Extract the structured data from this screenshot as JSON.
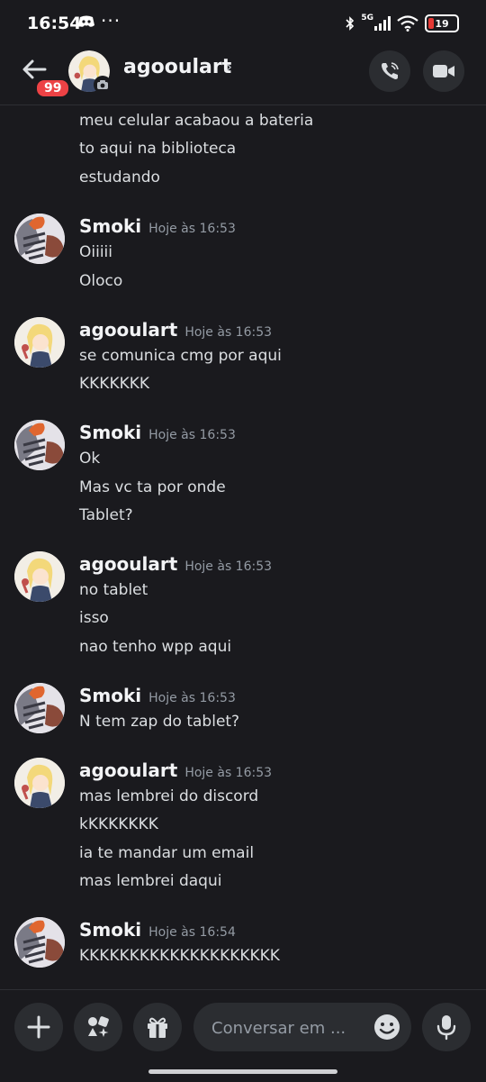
{
  "status_bar": {
    "time": "16:54",
    "more": "···",
    "network": "5G",
    "battery": "19",
    "battery_level": 0.19,
    "battery_color": "#e53935"
  },
  "header": {
    "badge": "99",
    "name": "agooulart",
    "chevron": "›"
  },
  "messages": {
    "g0": {
      "lines": [
        "meu celular acabaou a bateria",
        "to aqui na biblioteca",
        "estudando"
      ]
    },
    "g1": {
      "author": "Smoki",
      "time": "Hoje às 16:53",
      "lines": [
        "Oiiiii",
        "Oloco"
      ]
    },
    "g2": {
      "author": "agooulart",
      "time": "Hoje às 16:53",
      "lines": [
        "se comunica cmg por aqui",
        "KKKKKKK"
      ]
    },
    "g3": {
      "author": "Smoki",
      "time": "Hoje às 16:53",
      "lines": [
        "Ok",
        "Mas vc ta por onde",
        "Tablet?"
      ]
    },
    "g4": {
      "author": "agooulart",
      "time": "Hoje às 16:53",
      "lines": [
        "no tablet",
        "isso",
        "nao tenho wpp aqui"
      ]
    },
    "g5": {
      "author": "Smoki",
      "time": "Hoje às 16:53",
      "lines": [
        "N tem zap do tablet?"
      ]
    },
    "g6": {
      "author": "agooulart",
      "time": "Hoje às 16:53",
      "lines": [
        "mas lembrei do discord",
        "kKKKKKKK",
        "ia te mandar um email",
        "mas lembrei daqui"
      ]
    },
    "g7": {
      "author": "Smoki",
      "time": "Hoje às 16:54",
      "lines": [
        "KKKKKKKKKKKKKKKKKKKK"
      ]
    }
  },
  "composer": {
    "placeholder": "Conversar em ..."
  },
  "colors": {
    "background": "#1a1a1e",
    "surface": "#2b2d31",
    "badge": "#ed4245"
  }
}
